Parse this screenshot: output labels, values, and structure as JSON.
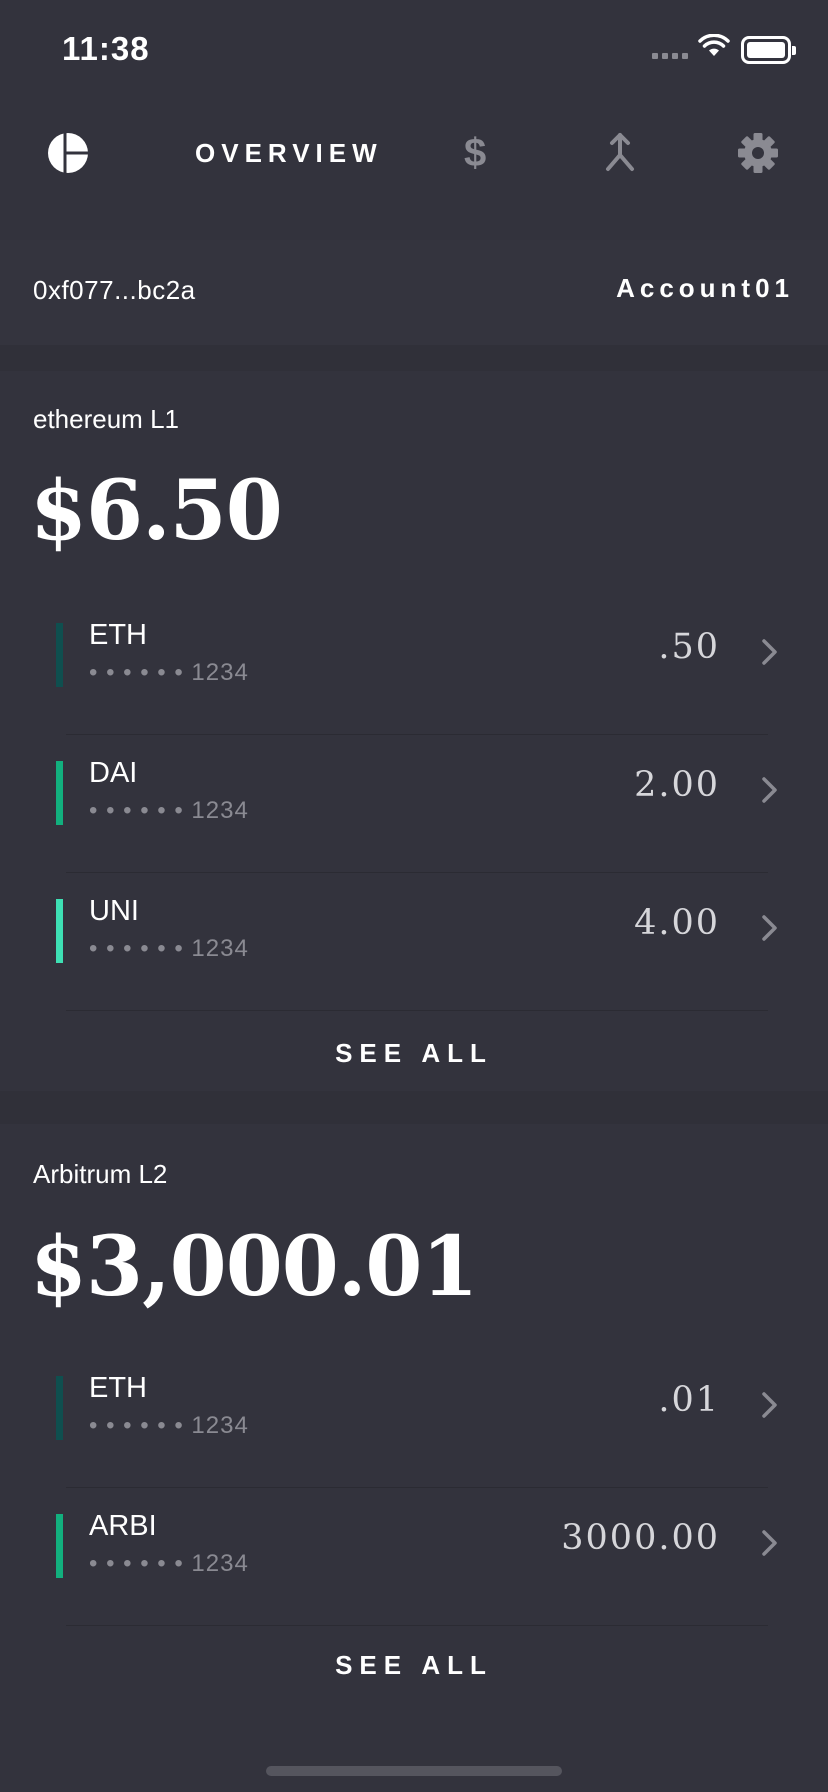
{
  "status_bar": {
    "time": "11:38"
  },
  "nav": {
    "active_label": "OVERVIEW",
    "dollar_glyph": "$",
    "icons": [
      "pie-chart-icon",
      "dollar-icon",
      "merge-arrow-icon",
      "gear-icon"
    ]
  },
  "account": {
    "address": "0xf077...bc2a",
    "name": "Account01"
  },
  "sections": [
    {
      "network": "ethereum L1",
      "total": "$6.50",
      "tokens": [
        {
          "symbol": "ETH",
          "masked": "• • • • • • 1234",
          "amount": ".50",
          "color": "#0f4f4f"
        },
        {
          "symbol": "DAI",
          "masked": "• • • • • • 1234",
          "amount": "2.00",
          "color": "#12b07e"
        },
        {
          "symbol": "UNI",
          "masked": "• • • • • • 1234",
          "amount": "4.00",
          "color": "#3ee0b4"
        }
      ],
      "see_all": "SEE ALL"
    },
    {
      "network": "Arbitrum L2",
      "total": "$3,000.01",
      "tokens": [
        {
          "symbol": "ETH",
          "masked": "• • • • • • 1234",
          "amount": ".01",
          "color": "#0f4f4f"
        },
        {
          "symbol": "ARBI",
          "masked": "• • • • • • 1234",
          "amount": "3000.00",
          "color": "#12b07e"
        }
      ],
      "see_all": "SEE ALL"
    }
  ],
  "theme": {
    "background": "#33333d",
    "muted": "#8a8a92"
  }
}
